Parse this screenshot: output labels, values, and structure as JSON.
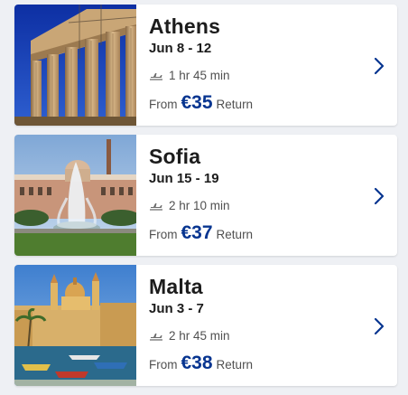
{
  "accent_color": "#073590",
  "destinations": [
    {
      "city": "Athens",
      "dates": "Jun 8 - 12",
      "duration": "1 hr 45 min",
      "from_label": "From",
      "price": "€35",
      "trip_type": "Return",
      "image": "parthenon-photo"
    },
    {
      "city": "Sofia",
      "dates": "Jun 15 - 19",
      "duration": "2 hr 10 min",
      "from_label": "From",
      "price": "€37",
      "trip_type": "Return",
      "image": "fountain-building-photo"
    },
    {
      "city": "Malta",
      "dates": "Jun 3 - 7",
      "duration": "2 hr 45 min",
      "from_label": "From",
      "price": "€38",
      "trip_type": "Return",
      "image": "harbour-church-photo"
    }
  ]
}
